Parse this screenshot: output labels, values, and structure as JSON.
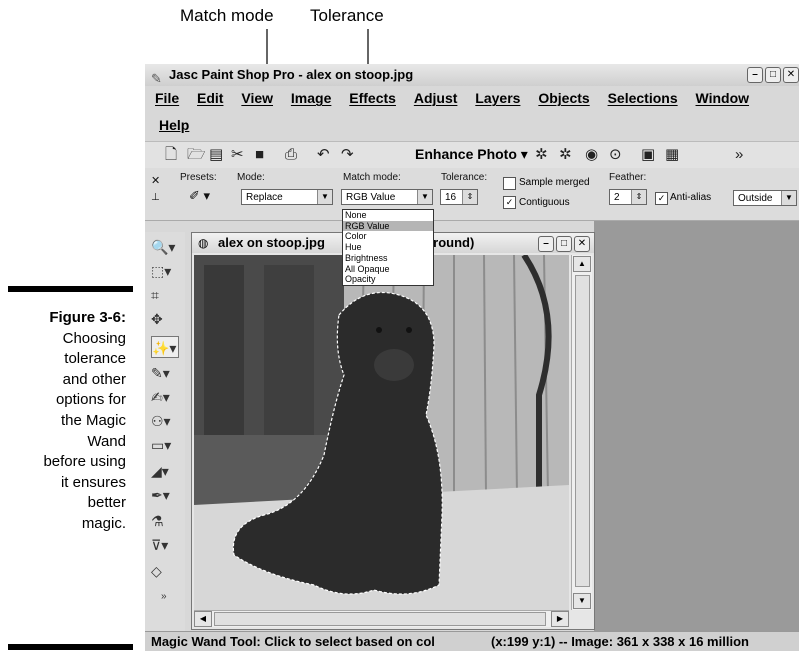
{
  "callouts": {
    "match_mode": "Match mode",
    "tolerance": "Tolerance"
  },
  "caption": {
    "label": "Figure 3-6:",
    "lines": [
      "Choosing",
      "tolerance",
      "and other",
      "options for",
      "the Magic",
      "Wand",
      "before using",
      "it ensures",
      "better",
      "magic."
    ]
  },
  "window": {
    "title": "Jasc Paint Shop Pro - alex on stoop.jpg",
    "controls": [
      "–",
      "□",
      "✕"
    ]
  },
  "menu": [
    "File",
    "Edit",
    "View",
    "Image",
    "Effects",
    "Adjust",
    "Layers",
    "Objects",
    "Selections",
    "Window",
    "Help"
  ],
  "toolbar": {
    "icons": [
      "new-icon",
      "open-icon",
      "browse-icon",
      "scan-icon",
      "save-icon",
      "print-icon",
      "undo-icon",
      "redo-icon"
    ],
    "enhance_photo": "Enhance Photo ▾",
    "more": "»"
  },
  "options": {
    "presets_label": "Presets:",
    "mode_label": "Mode:",
    "mode_value": "Replace",
    "match_mode_label": "Match mode:",
    "match_mode_value": "RGB Value",
    "tolerance_label": "Tolerance:",
    "tolerance_value": "16",
    "sample_merged": "Sample merged",
    "contiguous": "Contiguous",
    "contiguous_checked": true,
    "feather_label": "Feather:",
    "feather_value": "2",
    "anti_alias": "Anti-alias",
    "anti_alias_checked": true,
    "anti_alias_mode": "Outside"
  },
  "match_mode_options": [
    "None",
    "RGB Value",
    "Color",
    "Hue",
    "Brightness",
    "All Opaque",
    "Opacity"
  ],
  "match_mode_selected": "RGB Value",
  "document": {
    "title_left": "alex on stoop.jpg",
    "title_right": "kground)"
  },
  "status": {
    "hint": "Magic Wand Tool: Click to select based on col",
    "coords": "(x:199 y:1) -- Image:  361 x 338 x 16 million"
  }
}
